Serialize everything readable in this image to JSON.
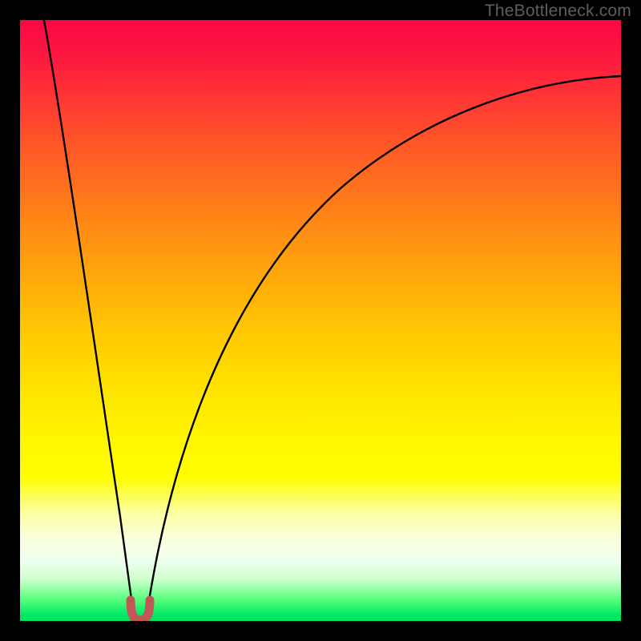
{
  "watermark": "TheBottleneck.com",
  "colors": {
    "frame": "#000000",
    "curve": "#000000",
    "knot": "#c05858",
    "gradient_top": "#fb0645",
    "gradient_bottom": "#00e261"
  },
  "chart_data": {
    "type": "line",
    "title": "",
    "xlabel": "",
    "ylabel": "",
    "xlim": [
      0,
      100
    ],
    "ylim": [
      0,
      100
    ],
    "note": "Values read off the plot as percentage of plot area; (0,0) = bottom-left, (100,100) = top-left. No axis ticks or labels rendered.",
    "series": [
      {
        "name": "left-branch",
        "x": [
          4.0,
          6.0,
          8.0,
          10.0,
          12.0,
          14.0,
          16.0,
          17.0,
          18.0,
          18.7
        ],
        "y": [
          100.0,
          86.0,
          72.0,
          58.0,
          44.0,
          30.0,
          16.0,
          9.0,
          4.0,
          1.0
        ]
      },
      {
        "name": "right-branch",
        "x": [
          21.3,
          22.5,
          24.0,
          27.0,
          31.0,
          36.0,
          42.0,
          50.0,
          60.0,
          72.0,
          86.0,
          100.0
        ],
        "y": [
          1.0,
          5.0,
          12.0,
          24.0,
          36.0,
          47.0,
          57.0,
          66.0,
          74.0,
          81.0,
          86.0,
          90.0
        ]
      },
      {
        "name": "valley-knot",
        "x": [
          18.7,
          19.5,
          20.0,
          20.5,
          21.3
        ],
        "y": [
          1.0,
          0.3,
          0.2,
          0.3,
          1.0
        ]
      }
    ],
    "grid": false,
    "legend": false
  }
}
